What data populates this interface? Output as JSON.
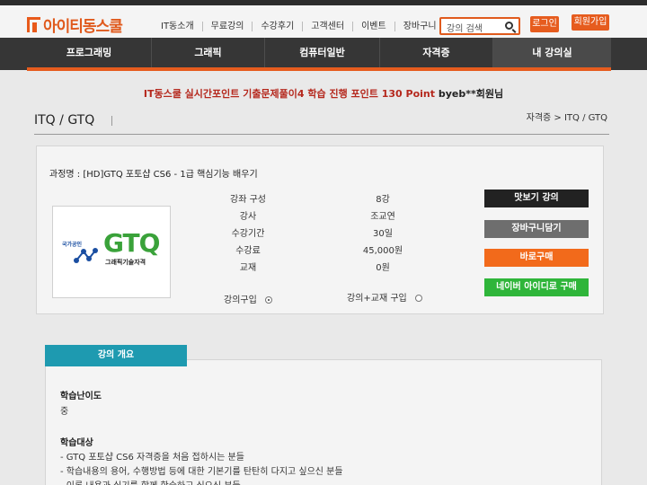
{
  "header": {
    "logo_text": "아이티동스쿨",
    "nav": [
      "IT동소개",
      "무료강의",
      "수강후기",
      "고객센터",
      "이벤트",
      "장바구니"
    ],
    "search_placeholder": "강의 검색",
    "login_label": "로그인",
    "join_label": "회원가입"
  },
  "categories": [
    "프로그래밍",
    "그래픽",
    "컴퓨터일반",
    "자격증",
    "내 강의실"
  ],
  "notice": {
    "text": "IT동스쿨 실시간포인트 기출문제풀이4 학습 진행 포인트",
    "points": "130 Point",
    "user": "byeb**회원님"
  },
  "page": {
    "title": "ITQ / GTQ",
    "breadcrumb": "자격증 > ITQ / GTQ"
  },
  "course": {
    "name": "과정명 : [HD]GTQ 포토샵 CS6 - 1급 핵심기능 배우기",
    "thumb": {
      "small_text": "국가공인",
      "logo_text": "GTQ",
      "sub_text": "그래픽기술자격"
    },
    "info": [
      {
        "label": "강좌 구성",
        "value": "8강"
      },
      {
        "label": "강사",
        "value": "조교연"
      },
      {
        "label": "수강기간",
        "value": "30일"
      },
      {
        "label": "수강료",
        "value": "45,000원"
      },
      {
        "label": "교재",
        "value": "0원"
      }
    ],
    "option_lecture": "강의구입",
    "option_lecture_book": "강의+교재 구입",
    "buttons": {
      "preview": "맛보기 강의",
      "cart": "장바구니담기",
      "buy": "바로구매",
      "naver": "네이버 아이디로 구매"
    }
  },
  "overview": {
    "tab": "강의 개요",
    "difficulty_title": "학습난이도",
    "difficulty_value": "중",
    "target_title": "학습대상",
    "target_items": [
      "- GTQ 포토샵 CS6 자격증을 처음 접하시는 분들",
      "- 학습내용의 용어, 수행방법 등에 대한 기본기를 탄탄히 다지고 싶으신 분들",
      "- 이론 내용과 실기를 함께 학습하고 싶으신 분들"
    ]
  }
}
